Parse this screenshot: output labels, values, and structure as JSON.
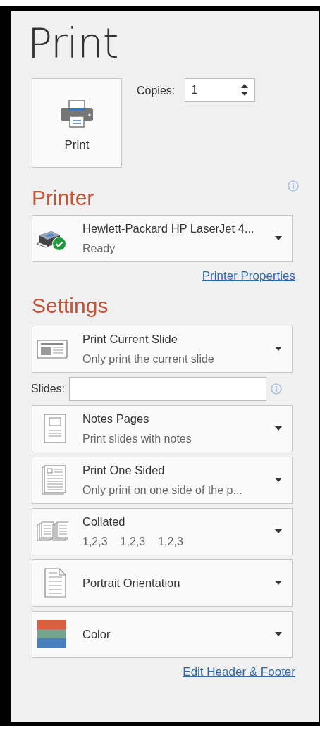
{
  "title": "Print",
  "print_button": {
    "label": "Print"
  },
  "copies": {
    "label": "Copies:",
    "value": "1"
  },
  "printer": {
    "heading": "Printer",
    "name": "Hewlett-Packard HP LaserJet 4...",
    "status": "Ready",
    "properties_link": "Printer Properties"
  },
  "settings": {
    "heading": "Settings",
    "items": [
      {
        "kind": "slide",
        "title": "Print Current Slide",
        "subtitle": "Only print the current slide"
      },
      {
        "kind": "slides-field",
        "label": "Slides:"
      },
      {
        "kind": "notes",
        "title": "Notes Pages",
        "subtitle": "Print slides with notes"
      },
      {
        "kind": "sided",
        "title": "Print One Sided",
        "subtitle": "Only print on one side of the p..."
      },
      {
        "kind": "collated",
        "title": "Collated",
        "sequence": [
          "1,2,3",
          "1,2,3",
          "1,2,3"
        ]
      },
      {
        "kind": "orientation",
        "title": "Portrait Orientation"
      },
      {
        "kind": "color",
        "title": "Color"
      }
    ],
    "footer_link": "Edit Header & Footer"
  }
}
